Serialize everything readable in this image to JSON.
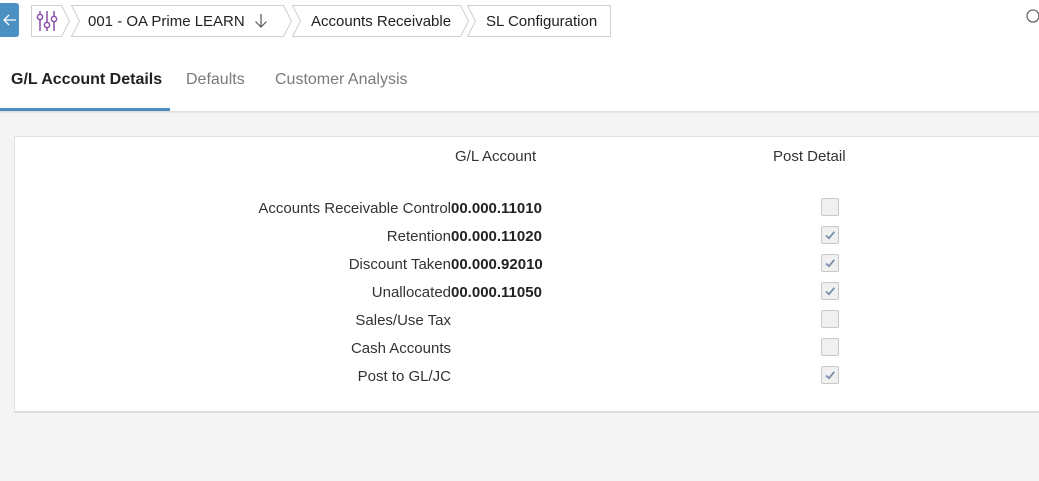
{
  "breadcrumb": {
    "settings_icon": "sliders-icon",
    "company": "001 - OA Prime LEARN",
    "module": "Accounts Receivable",
    "page": "SL Configuration"
  },
  "tabs": [
    {
      "label": "G/L Account Details",
      "active": true
    },
    {
      "label": "Defaults",
      "active": false
    },
    {
      "label": "Customer Analysis",
      "active": false
    }
  ],
  "table": {
    "headers": {
      "account": "G/L Account",
      "post_detail": "Post Detail"
    },
    "rows": [
      {
        "label": "Accounts Receivable Control",
        "account": "00.000.11010",
        "post_detail": false
      },
      {
        "label": "Retention",
        "account": "00.000.11020",
        "post_detail": true
      },
      {
        "label": "Discount Taken",
        "account": "00.000.92010",
        "post_detail": true
      },
      {
        "label": "Unallocated",
        "account": "00.000.11050",
        "post_detail": true
      },
      {
        "label": "Sales/Use Tax",
        "account": "",
        "post_detail": false
      },
      {
        "label": "Cash Accounts",
        "account": "",
        "post_detail": false
      },
      {
        "label": "Post to GL/JC",
        "account": "",
        "post_detail": true
      }
    ]
  },
  "colors": {
    "accent": "#4a90c2",
    "icon_purple": "#8a4fa8",
    "active_tab_underline": "#4a8fc0",
    "check_color": "#7a8fa8"
  }
}
